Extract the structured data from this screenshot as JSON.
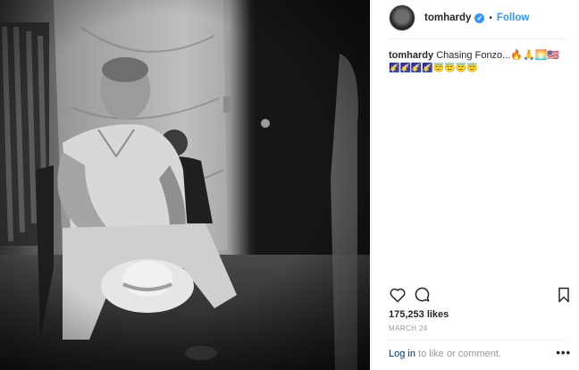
{
  "post": {
    "username": "tomhardy",
    "verified_icon": "verified-badge-icon",
    "separator": "•",
    "follow_label": "Follow",
    "caption": {
      "username": "tomhardy",
      "text": "Chasing Fonzo...🔥🙏🌅🇺🇸",
      "emoji_line": "🌠🌠🌠🌠😇😇😇😇"
    },
    "likes": "175,253 likes",
    "date": "MARCH 24",
    "comment_prompt": {
      "login_label": "Log in",
      "rest": " to like or comment."
    },
    "more_label": "•••"
  },
  "colors": {
    "accent": "#3897f0",
    "text": "#262626",
    "muted": "#999999",
    "link": "#003569"
  }
}
